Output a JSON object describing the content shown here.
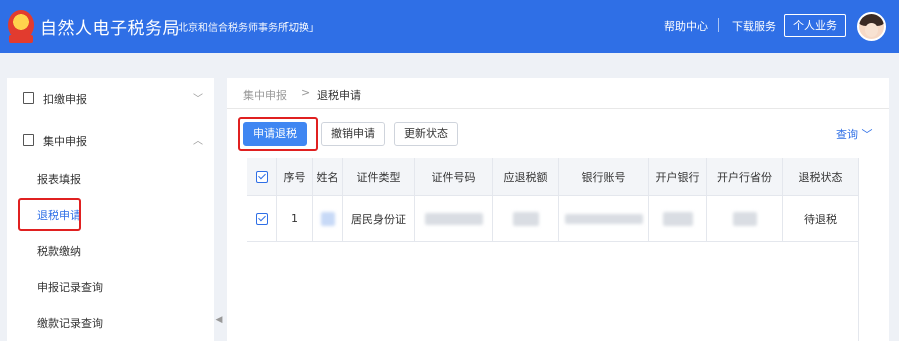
{
  "header": {
    "brand": "自然人电子税务局",
    "firm": "北京和信合税务师事务所...",
    "switch": "「切换」",
    "help": "帮助中心",
    "download": "下载服务",
    "personal": "个人业务"
  },
  "sidebar": {
    "groups": [
      {
        "label": "扣缴申报",
        "chevron": "﹀"
      },
      {
        "label": "集中申报",
        "chevron": "︿"
      }
    ],
    "items": [
      {
        "label": "报表填报"
      },
      {
        "label": "退税申请"
      },
      {
        "label": "税款缴纳"
      },
      {
        "label": "申报记录查询"
      },
      {
        "label": "缴款记录查询"
      }
    ],
    "collapse": "◀"
  },
  "breadcrumb": {
    "first": "集中申报",
    "sep": ">",
    "current": "退税申请"
  },
  "toolbar": {
    "apply": "申请退税",
    "revoke": "撤销申请",
    "update": "更新状态",
    "query": "查询 ﹀"
  },
  "table": {
    "headers": [
      "序号",
      "姓名",
      "证件类型",
      "证件号码",
      "应退税额",
      "银行账号",
      "开户银行",
      "开户行省份",
      "退税状态"
    ],
    "rows": [
      {
        "index": "1",
        "id_type": "居民身份证",
        "status": "待退税"
      }
    ]
  },
  "colors": {
    "brand": "#2f6fe6",
    "primary_button": "#3f86f2",
    "highlight_box": "#e02020"
  }
}
